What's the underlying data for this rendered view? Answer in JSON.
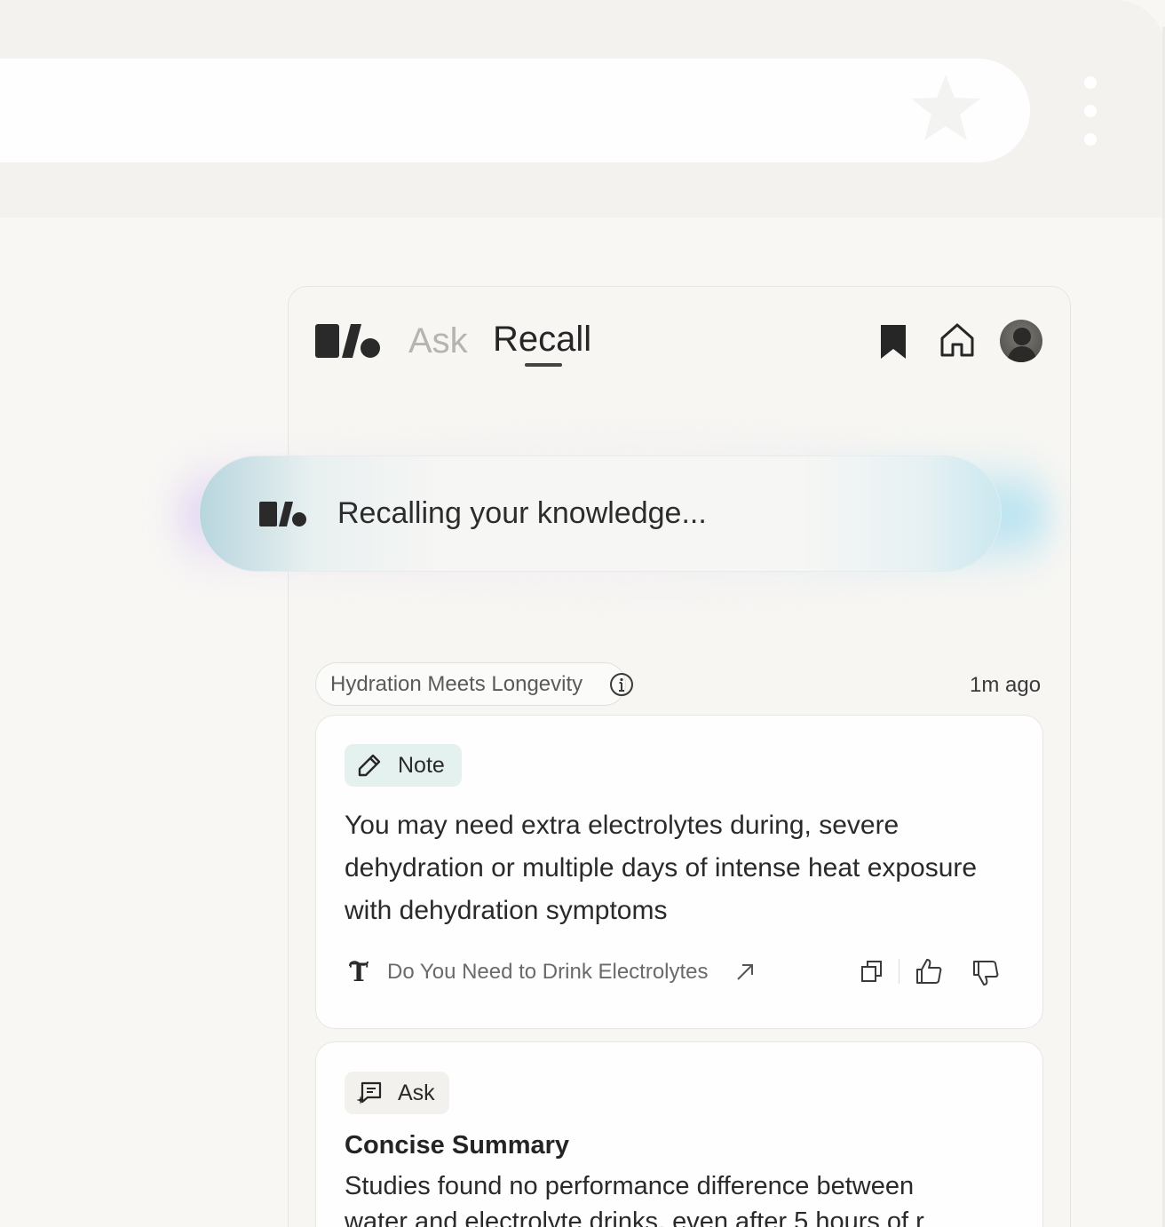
{
  "header": {
    "tabs": [
      {
        "label": "Ask",
        "active": false
      },
      {
        "label": "Recall",
        "active": true
      }
    ]
  },
  "status": {
    "text": "Recalling your knowledge..."
  },
  "result_group": {
    "topic": "Hydration Meets Longevity",
    "time_ago": "1m ago"
  },
  "note_card": {
    "badge": "Note",
    "text": "You may need extra electrolytes during, severe dehydration or multiple days of intense heat exposure with dehydration symptoms",
    "source_title": "Do You Need to Drink Electrolytes"
  },
  "ask_card": {
    "badge": "Ask",
    "title": "Concise Summary",
    "text_line1": "Studies found no performance difference between",
    "text_line2": "water and electrolyte drinks, even after 5 hours of r"
  },
  "colors": {
    "background": "#f8f7f4",
    "note_badge": "#e5f1ee",
    "glow_left": "#cfb4f5",
    "glow_right": "#8cd7f0"
  },
  "icons": [
    "star-icon",
    "kebab-menu-icon",
    "app-logo",
    "bookmark-icon",
    "home-icon",
    "info-icon",
    "pencil-icon",
    "source-logo",
    "external-link-icon",
    "copy-icon",
    "thumbs-up-icon",
    "thumbs-down-icon",
    "chat-sparkle-icon"
  ]
}
